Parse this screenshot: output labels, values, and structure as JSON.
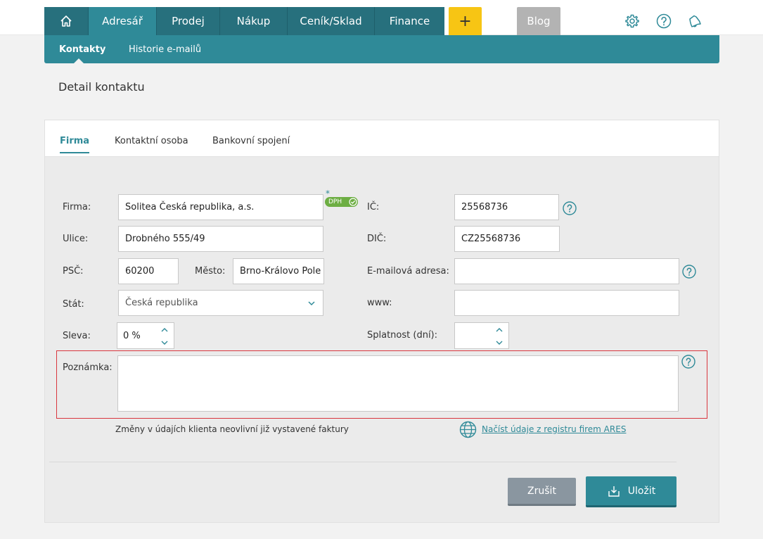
{
  "nav": {
    "items": [
      {
        "label": "Adresář",
        "active": true
      },
      {
        "label": "Prodej"
      },
      {
        "label": "Nákup"
      },
      {
        "label": "Ceník/Sklad"
      },
      {
        "label": "Finance"
      }
    ],
    "plus_label": "+",
    "blog_label": "Blog",
    "icons": [
      "home-icon",
      "gear-icon",
      "help-icon",
      "bell-icon"
    ]
  },
  "subnav": {
    "items": [
      {
        "label": "Kontakty",
        "active": true
      },
      {
        "label": "Historie e-mailů"
      }
    ]
  },
  "page": {
    "title": "Detail kontaktu"
  },
  "tabs": [
    {
      "label": "Firma",
      "active": true
    },
    {
      "label": "Kontaktní osoba"
    },
    {
      "label": "Bankovní spojení"
    }
  ],
  "form": {
    "firma_label": "Firma:",
    "firma_value": "Solitea Česká republika, a.s.",
    "dph_badge": "DPH",
    "asterisk": "*",
    "ulice_label": "Ulice:",
    "ulice_value": "Drobného 555/49",
    "psc_label": "PSČ:",
    "psc_value": "60200",
    "mesto_label": "Město:",
    "mesto_value": "Brno-Královo Pole",
    "stat_label": "Stát:",
    "stat_value": "Česká republika",
    "sleva_label": "Sleva:",
    "sleva_value": "0 %",
    "ic_label": "IČ:",
    "ic_value": "25568736",
    "dic_label": "DIČ:",
    "dic_value": "CZ25568736",
    "email_label": "E-mailová adresa:",
    "email_value": "",
    "www_label": "www:",
    "www_value": "",
    "splatnost_label": "Splatnost (dní):",
    "splatnost_value": "",
    "poznamka_label": "Poznámka:",
    "poznamka_value": ""
  },
  "info_text": "Změny v údajích klienta neovlivní již vystavené faktury",
  "ares_link": "Načíst údaje z registru firem ARES",
  "buttons": {
    "cancel": "Zrušit",
    "save": "Uložit"
  },
  "colors": {
    "primary": "#2f8a98",
    "dark": "#27707d",
    "accent": "#f7c514",
    "error_border": "#d9363e",
    "badge": "#6dae43"
  }
}
